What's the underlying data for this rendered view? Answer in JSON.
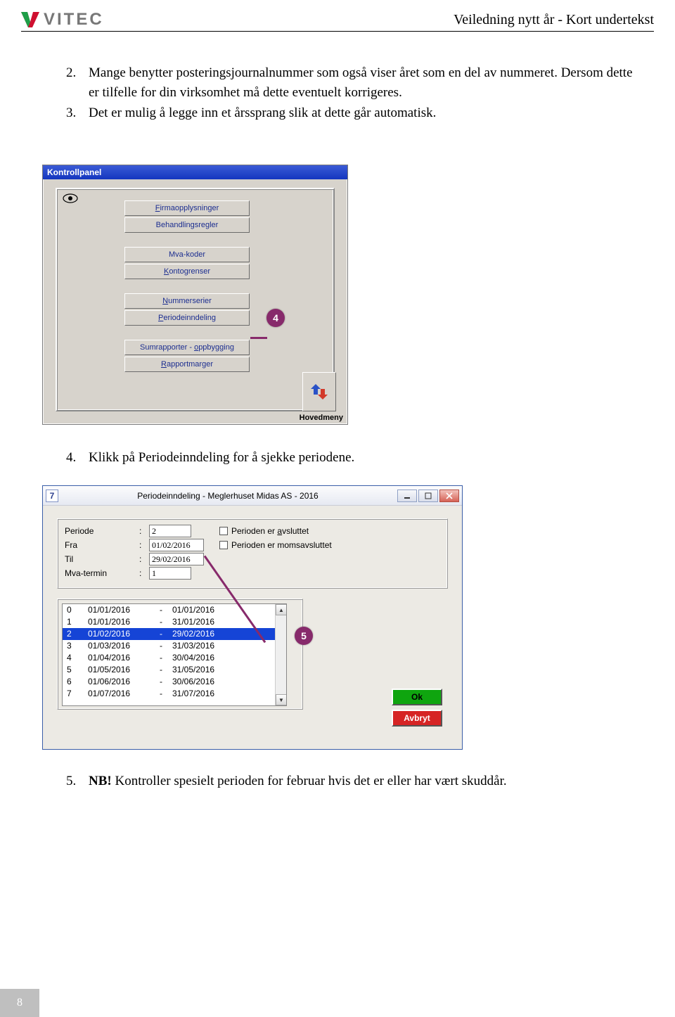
{
  "header": {
    "logo_text": "VITEC",
    "doc_title": "Veiledning nytt år - Kort undertekst"
  },
  "intro": {
    "items": [
      {
        "num": "2.",
        "text": "Mange benytter posteringsjournalnummer som også viser året som en del av nummeret. Dersom dette er tilfelle for din virksomhet må dette eventuelt korrigeres."
      },
      {
        "num": "3.",
        "text": "Det er mulig å legge inn et årssprang slik at dette går automatisk."
      }
    ]
  },
  "kp": {
    "title": "Kontrollpanel",
    "buttons": {
      "firma": "irmaopplysninger",
      "firma_u": "F",
      "beh": "Behandlingsregler",
      "mva": "Mva-koder",
      "konto_u": "K",
      "konto": "ontogrenser",
      "num_u": "N",
      "num": "ummerserier",
      "periode_u": "P",
      "periode": "eriodeinndeling",
      "sum_a": "Sumrapporter - ",
      "sum_u": "o",
      "sum_b": "ppbygging",
      "rapp_u": "R",
      "rapp": "apportmarger"
    },
    "hovedmeny": "Hovedmeny",
    "callout": "4"
  },
  "mid": {
    "num": "4.",
    "text": "Klikk på Periodeinndeling for å sjekke periodene."
  },
  "pi": {
    "icon": "7",
    "title": "Periodeinndeling - Meglerhuset Midas AS - 2016",
    "labels": {
      "periode": "Periode",
      "fra": "Fra",
      "til": "Til",
      "mva": "Mva-termin"
    },
    "values": {
      "periode": "2",
      "fra": "01/02/2016",
      "til": "29/02/2016",
      "mva": "1"
    },
    "checks": {
      "avsluttet_u": "a",
      "avsluttet": "Perioden er ",
      "avsluttet_b": "vsluttet",
      "moms": "Perioden er momsavsluttet"
    },
    "rows": [
      {
        "idx": "0",
        "from": "01/01/2016",
        "to": "01/01/2016"
      },
      {
        "idx": "1",
        "from": "01/01/2016",
        "to": "31/01/2016"
      },
      {
        "idx": "2",
        "from": "01/02/2016",
        "to": "29/02/2016",
        "sel": true
      },
      {
        "idx": "3",
        "from": "01/03/2016",
        "to": "31/03/2016"
      },
      {
        "idx": "4",
        "from": "01/04/2016",
        "to": "30/04/2016"
      },
      {
        "idx": "5",
        "from": "01/05/2016",
        "to": "31/05/2016"
      },
      {
        "idx": "6",
        "from": "01/06/2016",
        "to": "30/06/2016"
      },
      {
        "idx": "7",
        "from": "01/07/2016",
        "to": "31/07/2016"
      }
    ],
    "ok": "Ok",
    "cancel": "Avbryt",
    "callout": "5"
  },
  "bottom": {
    "num": "5.",
    "nb": "NB!",
    "text": " Kontroller spesielt perioden for februar hvis det er eller har vært skuddår."
  },
  "page_num": "8"
}
